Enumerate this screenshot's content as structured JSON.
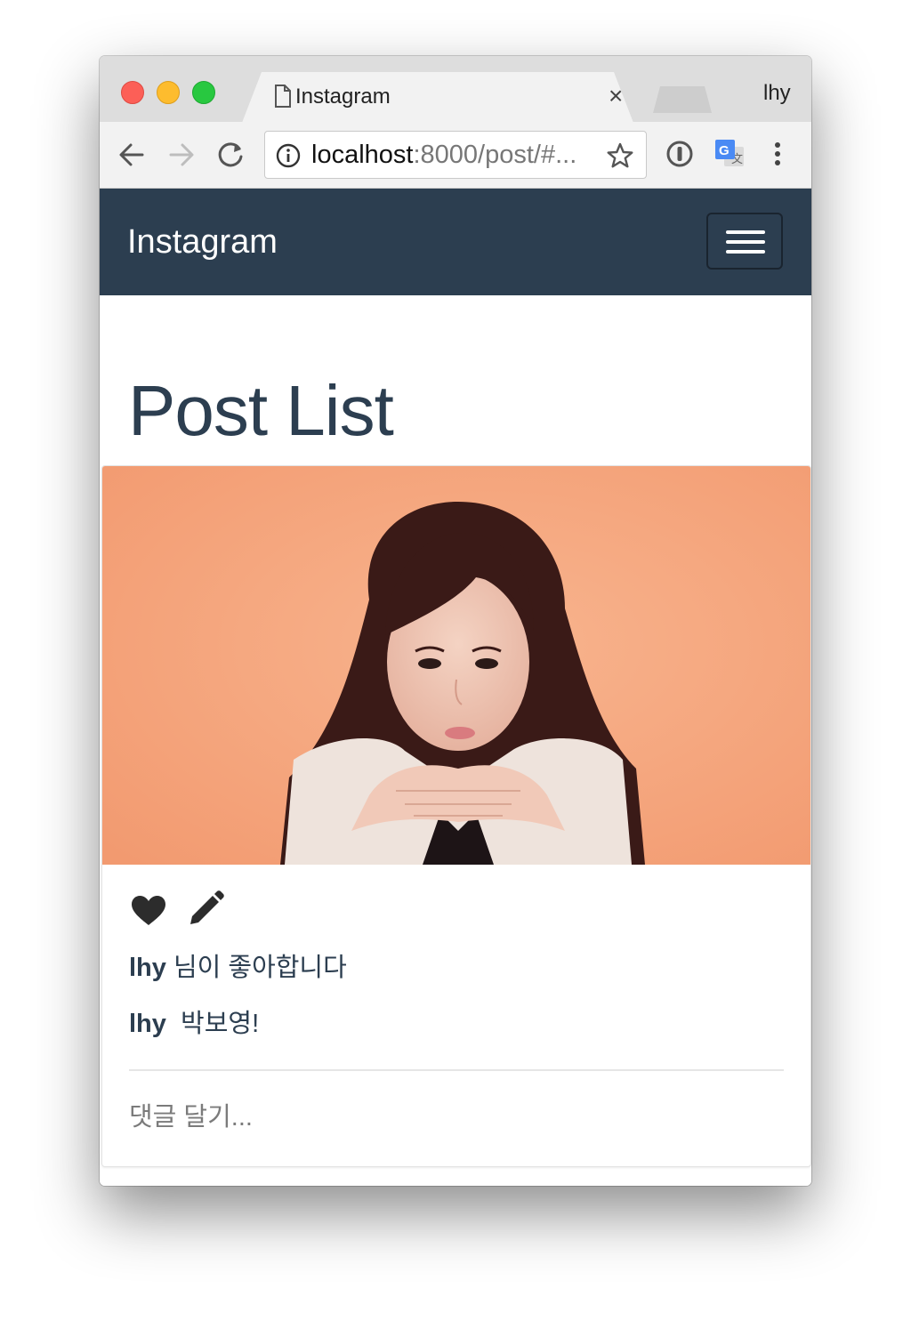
{
  "browser": {
    "tab_title": "Instagram",
    "tab_close_glyph": "×",
    "profile_name": "lhy",
    "url_host": "localhost",
    "url_rest": ":8000/post/#...",
    "icons": {
      "back": "back-arrow-icon",
      "forward": "forward-arrow-icon",
      "reload": "reload-icon",
      "info": "info-icon",
      "bookmark": "star-icon",
      "password": "password-manager-icon",
      "translate": "google-translate-icon",
      "menu": "more-vert-icon"
    }
  },
  "navbar": {
    "brand": "Instagram",
    "bg_color": "#2c3e50"
  },
  "page": {
    "title": "Post List"
  },
  "post": {
    "image_background": "#f7ac82",
    "like_user": "lhy",
    "like_text": "님이 좋아합니다",
    "author": "lhy",
    "caption": "박보영!",
    "comment_placeholder": "댓글 달기..."
  }
}
